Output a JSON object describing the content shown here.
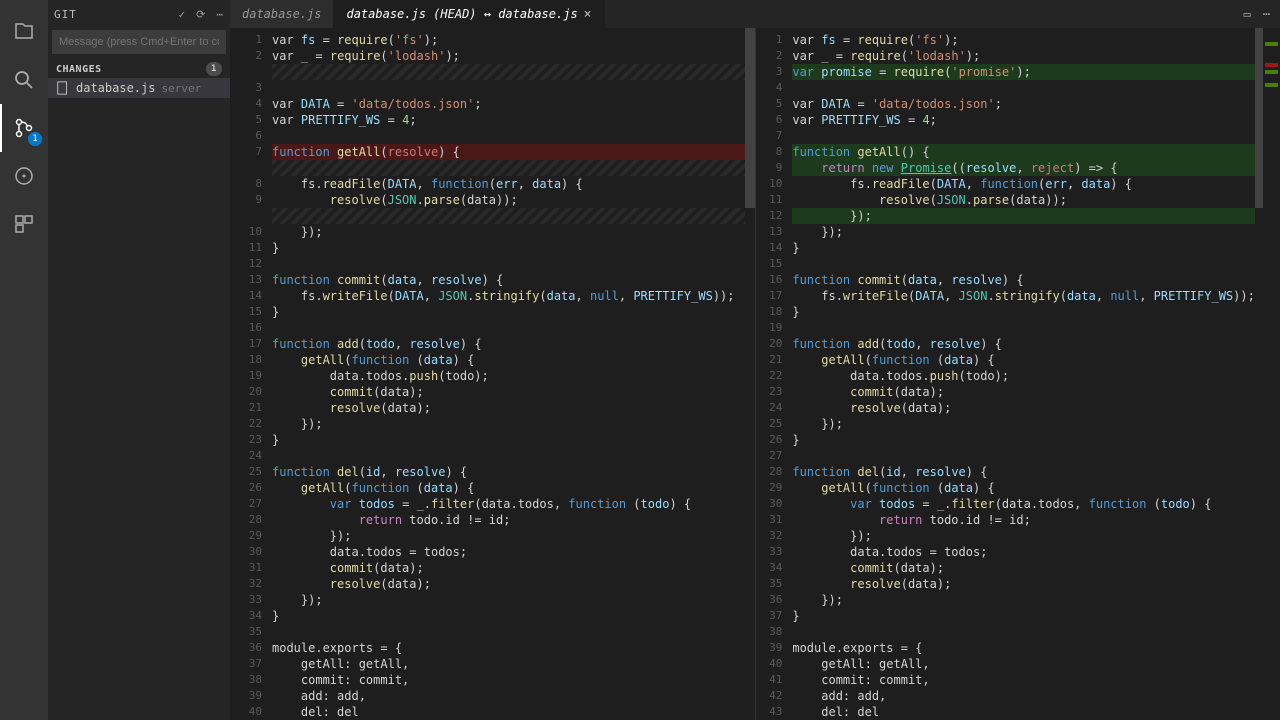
{
  "activity": {
    "scm_badge": "1"
  },
  "sidebar": {
    "title": "GIT",
    "commit_placeholder": "Message (press Cmd+Enter to commit)",
    "section_changes": "CHANGES",
    "changes_count": "1",
    "change_file": "database.js",
    "change_path": "server"
  },
  "tabs": {
    "t1": "database.js",
    "t2": "database.js (HEAD) ↔ database.js"
  },
  "editor": {
    "left": {
      "lines": [
        {
          "n": "1",
          "h": "var <v>fs</v> <op>=</op> <fn>require</fn>(<s>'fs'</s>);"
        },
        {
          "n": "2",
          "h": "var <v>_</v> <op>=</op> <fn>require</fn>(<s>'lodash'</s>);"
        },
        {
          "n": "",
          "h": "",
          "cls": "hatched"
        },
        {
          "n": "3",
          "h": ""
        },
        {
          "n": "4",
          "h": "var <v>DATA</v> <op>=</op> <s>'data/todos.json'</s>;"
        },
        {
          "n": "5",
          "h": "var <v>PRETTIFY_WS</v> <op>=</op> <num>4</num>;"
        },
        {
          "n": "6",
          "h": ""
        },
        {
          "n": "7",
          "h": "<kw>function</kw> <fn>getAll</fn>(<rej>resolve</rej>) {",
          "cls": "removed"
        },
        {
          "n": "",
          "h": "",
          "cls": "hatched"
        },
        {
          "n": "8",
          "h": "    fs.<fn>readFile</fn>(<v>DATA</v>, <kw>function</kw>(<v>err</v>, <v>data</v>) {"
        },
        {
          "n": "9",
          "h": "        <fn>resolve</fn>(<t>JSON</t>.<fn>parse</fn>(data));"
        },
        {
          "n": "",
          "h": "",
          "cls": "hatched"
        },
        {
          "n": "10",
          "h": "    });"
        },
        {
          "n": "11",
          "h": "}"
        },
        {
          "n": "12",
          "h": ""
        },
        {
          "n": "13",
          "h": "<kw>function</kw> <fn>commit</fn>(<v>data</v>, <v>resolve</v>) {"
        },
        {
          "n": "14",
          "h": "    fs.<fn>writeFile</fn>(<v>DATA</v>, <t>JSON</t>.<fn>stringify</fn>(<v>data</v>, <kw>null</kw>, <v>PRETTIFY_WS</v>));"
        },
        {
          "n": "15",
          "h": "}"
        },
        {
          "n": "16",
          "h": ""
        },
        {
          "n": "17",
          "h": "<kw>function</kw> <fn>add</fn>(<v>todo</v>, <v>resolve</v>) {"
        },
        {
          "n": "18",
          "h": "    <fn>getAll</fn>(<kw>function</kw> (<v>data</v>) {"
        },
        {
          "n": "19",
          "h": "        data.todos.<fn>push</fn>(todo);"
        },
        {
          "n": "20",
          "h": "        <fn>commit</fn>(data);"
        },
        {
          "n": "21",
          "h": "        <fn>resolve</fn>(data);"
        },
        {
          "n": "22",
          "h": "    });"
        },
        {
          "n": "23",
          "h": "}"
        },
        {
          "n": "24",
          "h": ""
        },
        {
          "n": "25",
          "h": "<kw>function</kw> <fn>del</fn>(<v>id</v>, <v>resolve</v>) {"
        },
        {
          "n": "26",
          "h": "    <fn>getAll</fn>(<kw>function</kw> (<v>data</v>) {"
        },
        {
          "n": "27",
          "h": "        <kw>var</kw> <v>todos</v> <op>=</op> _.<fn>filter</fn>(data.todos, <kw>function</kw> (<v>todo</v>) {"
        },
        {
          "n": "28",
          "h": "            <ret>return</ret> todo.id <op>!=</op> id;"
        },
        {
          "n": "29",
          "h": "        });"
        },
        {
          "n": "30",
          "h": "        data.todos <op>=</op> todos;"
        },
        {
          "n": "31",
          "h": "        <fn>commit</fn>(data);"
        },
        {
          "n": "32",
          "h": "        <fn>resolve</fn>(data);"
        },
        {
          "n": "33",
          "h": "    });"
        },
        {
          "n": "34",
          "h": "}"
        },
        {
          "n": "35",
          "h": ""
        },
        {
          "n": "36",
          "h": "module.exports <op>=</op> {"
        },
        {
          "n": "37",
          "h": "    getAll<op>:</op> getAll,"
        },
        {
          "n": "38",
          "h": "    commit<op>:</op> commit,"
        },
        {
          "n": "39",
          "h": "    add<op>:</op> add,"
        },
        {
          "n": "40",
          "h": "    del<op>:</op> del"
        }
      ]
    },
    "right": {
      "lines": [
        {
          "n": "1",
          "h": "var <v>fs</v> <op>=</op> <fn>require</fn>(<s>'fs'</s>);"
        },
        {
          "n": "2",
          "h": "var <v>_</v> <op>=</op> <fn>require</fn>(<s>'lodash'</s>);"
        },
        {
          "n": "3",
          "h": "<kw>var</kw> <v>promise</v> <op>=</op> <fn>require</fn>(<s>'promise'</s>);",
          "cls": "added"
        },
        {
          "n": "4",
          "h": ""
        },
        {
          "n": "5",
          "h": "var <v>DATA</v> <op>=</op> <s>'data/todos.json'</s>;"
        },
        {
          "n": "6",
          "h": "var <v>PRETTIFY_WS</v> <op>=</op> <num>4</num>;"
        },
        {
          "n": "7",
          "h": ""
        },
        {
          "n": "8",
          "h": "<kw>function</kw> <fn>getAll</fn>() {",
          "cls": "added"
        },
        {
          "n": "9",
          "h": "    <ret>return</ret> <kw>new</kw> <u>Promise</u>((<v>resolve</v>, <rej>reject</rej>) <op>=></op> {",
          "cls": "added"
        },
        {
          "n": "10",
          "h": "        fs.<fn>readFile</fn>(<v>DATA</v>, <kw>function</kw>(<v>err</v>, <v>data</v>) {"
        },
        {
          "n": "11",
          "h": "            <fn>resolve</fn>(<t>JSON</t>.<fn>parse</fn>(data));"
        },
        {
          "n": "12",
          "h": "        });",
          "cls": "added"
        },
        {
          "n": "13",
          "h": "    });"
        },
        {
          "n": "14",
          "h": "}"
        },
        {
          "n": "15",
          "h": ""
        },
        {
          "n": "16",
          "h": "<kw>function</kw> <fn>commit</fn>(<v>data</v>, <v>resolve</v>) {"
        },
        {
          "n": "17",
          "h": "    fs.<fn>writeFile</fn>(<v>DATA</v>, <t>JSON</t>.<fn>stringify</fn>(<v>data</v>, <kw>null</kw>, <v>PRETTIFY_WS</v>));"
        },
        {
          "n": "18",
          "h": "}"
        },
        {
          "n": "19",
          "h": ""
        },
        {
          "n": "20",
          "h": "<kw>function</kw> <fn>add</fn>(<v>todo</v>, <v>resolve</v>) {"
        },
        {
          "n": "21",
          "h": "    <fn>getAll</fn>(<kw>function</kw> (<v>data</v>) {"
        },
        {
          "n": "22",
          "h": "        data.todos.<fn>push</fn>(todo);"
        },
        {
          "n": "23",
          "h": "        <fn>commit</fn>(data);"
        },
        {
          "n": "24",
          "h": "        <fn>resolve</fn>(data);"
        },
        {
          "n": "25",
          "h": "    });"
        },
        {
          "n": "26",
          "h": "}"
        },
        {
          "n": "27",
          "h": ""
        },
        {
          "n": "28",
          "h": "<kw>function</kw> <fn>del</fn>(<v>id</v>, <v>resolve</v>) {"
        },
        {
          "n": "29",
          "h": "    <fn>getAll</fn>(<kw>function</kw> (<v>data</v>) {"
        },
        {
          "n": "30",
          "h": "        <kw>var</kw> <v>todos</v> <op>=</op> _.<fn>filter</fn>(data.todos, <kw>function</kw> (<v>todo</v>) {"
        },
        {
          "n": "31",
          "h": "            <ret>return</ret> todo.id <op>!=</op> id;"
        },
        {
          "n": "32",
          "h": "        });"
        },
        {
          "n": "33",
          "h": "        data.todos <op>=</op> todos;"
        },
        {
          "n": "34",
          "h": "        <fn>commit</fn>(data);"
        },
        {
          "n": "35",
          "h": "        <fn>resolve</fn>(data);"
        },
        {
          "n": "36",
          "h": "    });"
        },
        {
          "n": "37",
          "h": "}"
        },
        {
          "n": "38",
          "h": ""
        },
        {
          "n": "39",
          "h": "module.exports <op>=</op> {"
        },
        {
          "n": "40",
          "h": "    getAll<op>:</op> getAll,"
        },
        {
          "n": "41",
          "h": "    commit<op>:</op> commit,"
        },
        {
          "n": "42",
          "h": "    add<op>:</op> add,"
        },
        {
          "n": "43",
          "h": "    del<op>:</op> del"
        }
      ]
    }
  }
}
